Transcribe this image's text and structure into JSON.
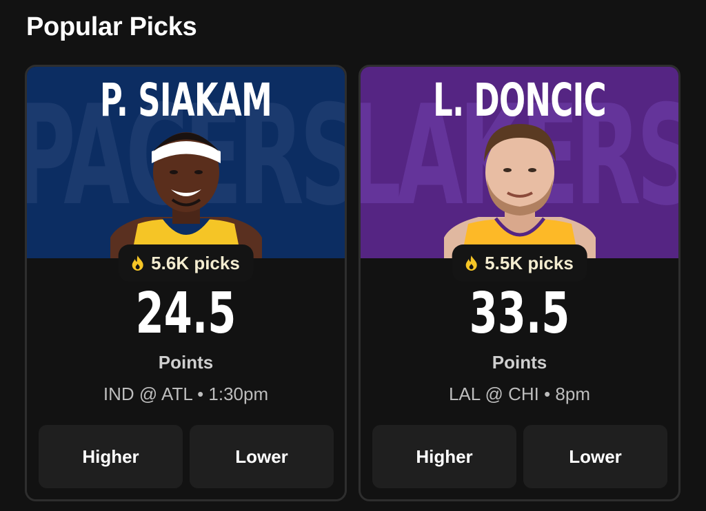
{
  "section": {
    "title": "Popular Picks"
  },
  "cards": [
    {
      "player_name": "P. SIAKAM",
      "team_watermark": "PACERS",
      "hero_color": "#0c2d62",
      "watermark_color": "#1b3a6e",
      "jersey_color": "#f5c526",
      "picks": "5.6K picks",
      "line": "24.5",
      "stat": "Points",
      "game": "IND @ ATL • 1:30pm",
      "higher_label": "Higher",
      "lower_label": "Lower"
    },
    {
      "player_name": "L. DONCIC",
      "team_watermark": "LAKERS",
      "hero_color": "#552583",
      "watermark_color": "#64349a",
      "jersey_color": "#fdb927",
      "picks": "5.5K picks",
      "line": "33.5",
      "stat": "Points",
      "game": "LAL @ CHI • 8pm",
      "higher_label": "Higher",
      "lower_label": "Lower"
    }
  ],
  "icons": {
    "picks": "flame-icon"
  },
  "colors": {
    "background": "#121212",
    "pill_text": "#f3ecd0",
    "button_bg": "#1f1f1f"
  }
}
